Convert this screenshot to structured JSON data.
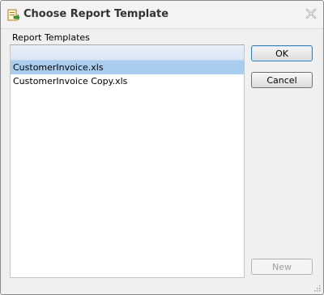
{
  "window": {
    "title": "Choose Report Template",
    "icon": "report-template-icon",
    "close_icon": "close-icon"
  },
  "templates": {
    "label": "Report Templates",
    "items": [
      {
        "name": "CustomerInvoice.xls",
        "selected": true
      },
      {
        "name": "CustomerInvoice Copy.xls",
        "selected": false
      }
    ]
  },
  "buttons": {
    "ok": "OK",
    "cancel": "Cancel",
    "new": "New",
    "new_enabled": false
  },
  "colors": {
    "selection": "#a9cdee",
    "default_button_border": "#3c7fb1"
  }
}
